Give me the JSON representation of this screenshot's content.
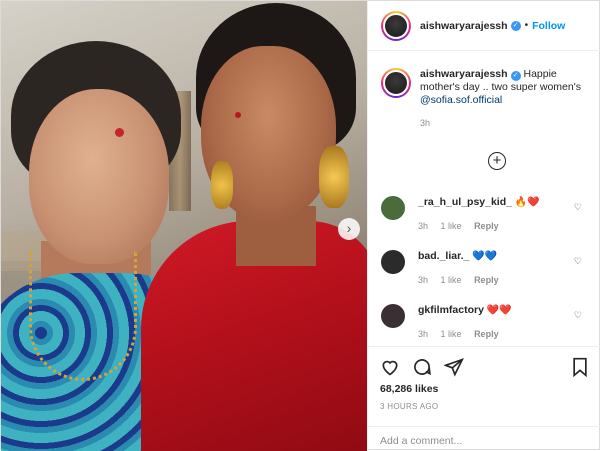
{
  "post": {
    "username": "aishwaryarajessh",
    "follow_label": "Follow",
    "separator": "•",
    "caption": {
      "text": "Happie mother's day .. two super women's",
      "mention": "@sofia.sof.official",
      "time": "3h"
    },
    "load_more_symbol": "+",
    "comments": [
      {
        "username": "_ra_h_ul_psy_kid_",
        "text": "🔥❤️",
        "time": "3h",
        "likes": "1 like",
        "reply": "Reply",
        "avatar_color": "#4a6b3a"
      },
      {
        "username": "bad._liar._",
        "text": "💙💙",
        "time": "3h",
        "likes": "1 like",
        "reply": "Reply",
        "avatar_color": "#2b2b2b"
      },
      {
        "username": "gkfilmfactory",
        "text": "❤️❤️",
        "time": "3h",
        "likes": "1 like",
        "reply": "Reply",
        "avatar_color": "#3a2f33"
      }
    ],
    "likes": "68,286 likes",
    "date": "3 HOURS AGO",
    "add_comment_placeholder": "Add a comment..."
  },
  "colors": {
    "accent": "#0095f6",
    "verified": "#3897f0",
    "secondary_text": "#8e8e8e"
  }
}
